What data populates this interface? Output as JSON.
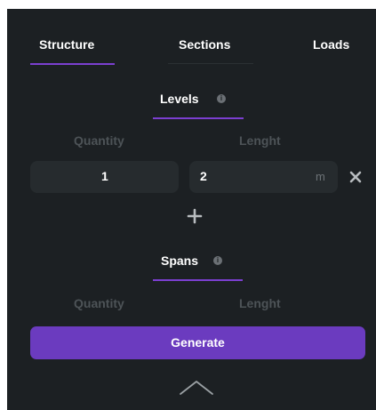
{
  "tabs": [
    {
      "label": "Structure",
      "active": true
    },
    {
      "label": "Sections",
      "active": false
    },
    {
      "label": "Loads",
      "active": false
    }
  ],
  "levels": {
    "title": "Levels",
    "quantity_label": "Quantity",
    "length_label": "Lenght",
    "quantity_value": "1",
    "length_value": "2",
    "length_unit": "m"
  },
  "spans": {
    "title": "Spans",
    "quantity_label": "Quantity",
    "length_label": "Lenght"
  },
  "actions": {
    "generate_label": "Generate"
  },
  "icons": {
    "info": "info-icon",
    "close": "close-icon",
    "add": "plus-icon",
    "collapse": "chevron-up-icon"
  },
  "colors": {
    "panel_bg": "#1c2023",
    "field_bg": "#262b2e",
    "accent": "#7b3fd0",
    "button": "#6b3bbf",
    "muted_text": "#4d5357"
  }
}
